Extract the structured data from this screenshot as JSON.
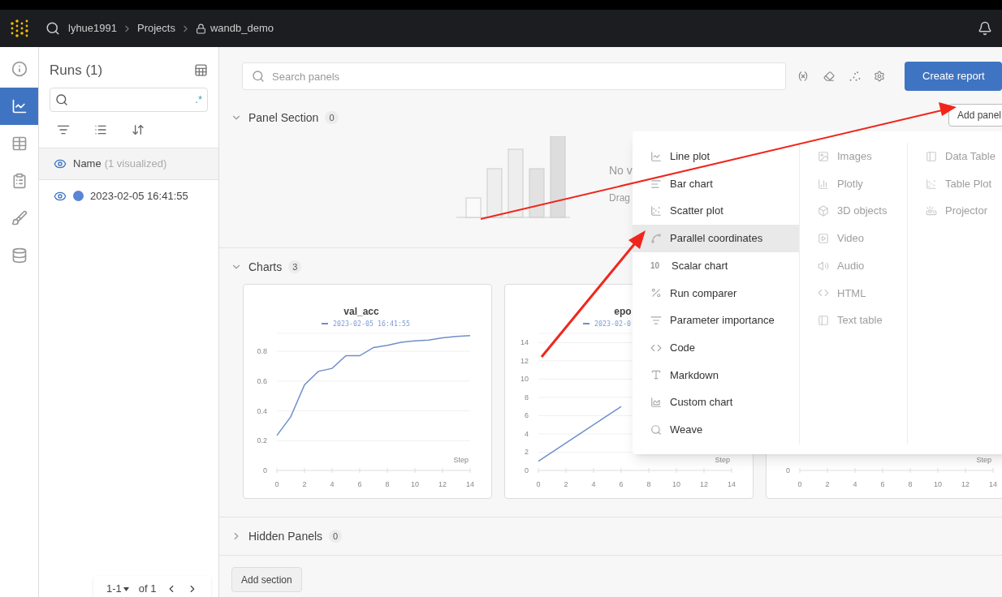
{
  "breadcrumbs": [
    {
      "label": "lyhue1991",
      "locked": false
    },
    {
      "label": "Projects",
      "locked": false
    },
    {
      "label": "wandb_demo",
      "locked": true
    }
  ],
  "rail": [
    {
      "selected": false
    },
    {
      "selected": true
    },
    {
      "selected": false
    },
    {
      "selected": false
    },
    {
      "selected": false
    },
    {
      "selected": false
    }
  ],
  "runs": {
    "title": "Runs (1)",
    "regex_toggle": ".*",
    "header": {
      "label": "Name",
      "note": "(1 visualized)"
    },
    "rows": [
      {
        "name": "2023-02-05 16:41:55",
        "color": "#5a84d4"
      }
    ],
    "pagination": {
      "range": "1-1",
      "total": "of 1"
    }
  },
  "toolbar": {
    "search_placeholder": "Search panels",
    "create_button": "Create report"
  },
  "sections": [
    {
      "title": "Panel Section",
      "count": "0",
      "expanded": true,
      "kind": "empty",
      "add_button": "Add panel",
      "empty_title": "No v",
      "empty_hint": "Drag"
    },
    {
      "title": "Charts",
      "count": "3",
      "expanded": true,
      "kind": "charts",
      "charts": [
        {
          "title": "val_acc",
          "chart_data": {
            "type": "line",
            "xlabel": "Step",
            "grid": true,
            "x": [
              0,
              1,
              2,
              3,
              4,
              5,
              6,
              7,
              8,
              9,
              10,
              11,
              12,
              13,
              14
            ],
            "series": [
              {
                "name": "2023-02-05 16:41:55",
                "color": "#6f8fc9",
                "values": [
                  0.235,
                  0.36,
                  0.575,
                  0.665,
                  0.685,
                  0.77,
                  0.77,
                  0.825,
                  0.84,
                  0.86,
                  0.87,
                  0.875,
                  0.89,
                  0.9,
                  0.905
                ]
              }
            ],
            "xlim": [
              0,
              14
            ],
            "ylim": [
              0,
              0.92
            ],
            "xticks": [
              0,
              2,
              4,
              6,
              8,
              10,
              12,
              14
            ],
            "yticks": [
              0,
              0.2,
              0.4,
              0.6,
              0.8
            ]
          }
        },
        {
          "title": "epo",
          "chart_data": {
            "type": "line",
            "xlabel": "Step",
            "grid": true,
            "x": [
              0,
              1,
              2,
              3,
              4,
              5,
              6
            ],
            "series": [
              {
                "name": "2023-02-0",
                "color": "#6f8fc9",
                "values": [
                  1,
                  2,
                  3,
                  4,
                  5,
                  6,
                  7
                ]
              }
            ],
            "xlim": [
              0,
              14
            ],
            "ylim": [
              0,
              15
            ],
            "xticks": [
              0,
              2,
              4,
              6,
              8,
              10,
              12,
              14
            ],
            "yticks": [
              0,
              2,
              4,
              6,
              8,
              10,
              12,
              14
            ]
          }
        },
        {
          "x_tick_labels": [
            "0",
            "2",
            "4",
            "6",
            "8",
            "10",
            "12",
            "14"
          ],
          "y_tick_labels": [
            "0"
          ],
          "axis_label": "Step"
        }
      ]
    },
    {
      "title": "Hidden Panels",
      "count": "0",
      "expanded": false,
      "kind": "hidden"
    }
  ],
  "add_section_button": "Add section",
  "add_panel_menu": {
    "columns": [
      [
        {
          "label": "Line plot",
          "disabled": false,
          "hovered": false
        },
        {
          "label": "Bar chart",
          "disabled": false,
          "hovered": false
        },
        {
          "label": "Scatter plot",
          "disabled": false,
          "hovered": false
        },
        {
          "label": "Parallel coordinates",
          "disabled": false,
          "hovered": true
        },
        {
          "label": "Scalar chart",
          "disabled": false,
          "hovered": false,
          "glyph": "10"
        },
        {
          "label": "Run comparer",
          "disabled": false,
          "hovered": false
        },
        {
          "label": "Parameter importance",
          "disabled": false,
          "hovered": false
        },
        {
          "label": "Code",
          "disabled": false,
          "hovered": false
        },
        {
          "label": "Markdown",
          "disabled": false,
          "hovered": false
        },
        {
          "label": "Custom chart",
          "disabled": false,
          "hovered": false
        },
        {
          "label": "Weave",
          "disabled": false,
          "hovered": false
        }
      ],
      [
        {
          "label": "Images",
          "disabled": true,
          "hovered": false
        },
        {
          "label": "Plotly",
          "disabled": true,
          "hovered": false
        },
        {
          "label": "3D objects",
          "disabled": true,
          "hovered": false
        },
        {
          "label": "Video",
          "disabled": true,
          "hovered": false
        },
        {
          "label": "Audio",
          "disabled": true,
          "hovered": false
        },
        {
          "label": "HTML",
          "disabled": true,
          "hovered": false
        },
        {
          "label": "Text table",
          "disabled": true,
          "hovered": false
        }
      ],
      [
        {
          "label": "Data Table",
          "disabled": true,
          "hovered": false
        },
        {
          "label": "Table Plot",
          "disabled": true,
          "hovered": false
        },
        {
          "label": "Projector",
          "disabled": true,
          "hovered": false
        }
      ]
    ]
  }
}
